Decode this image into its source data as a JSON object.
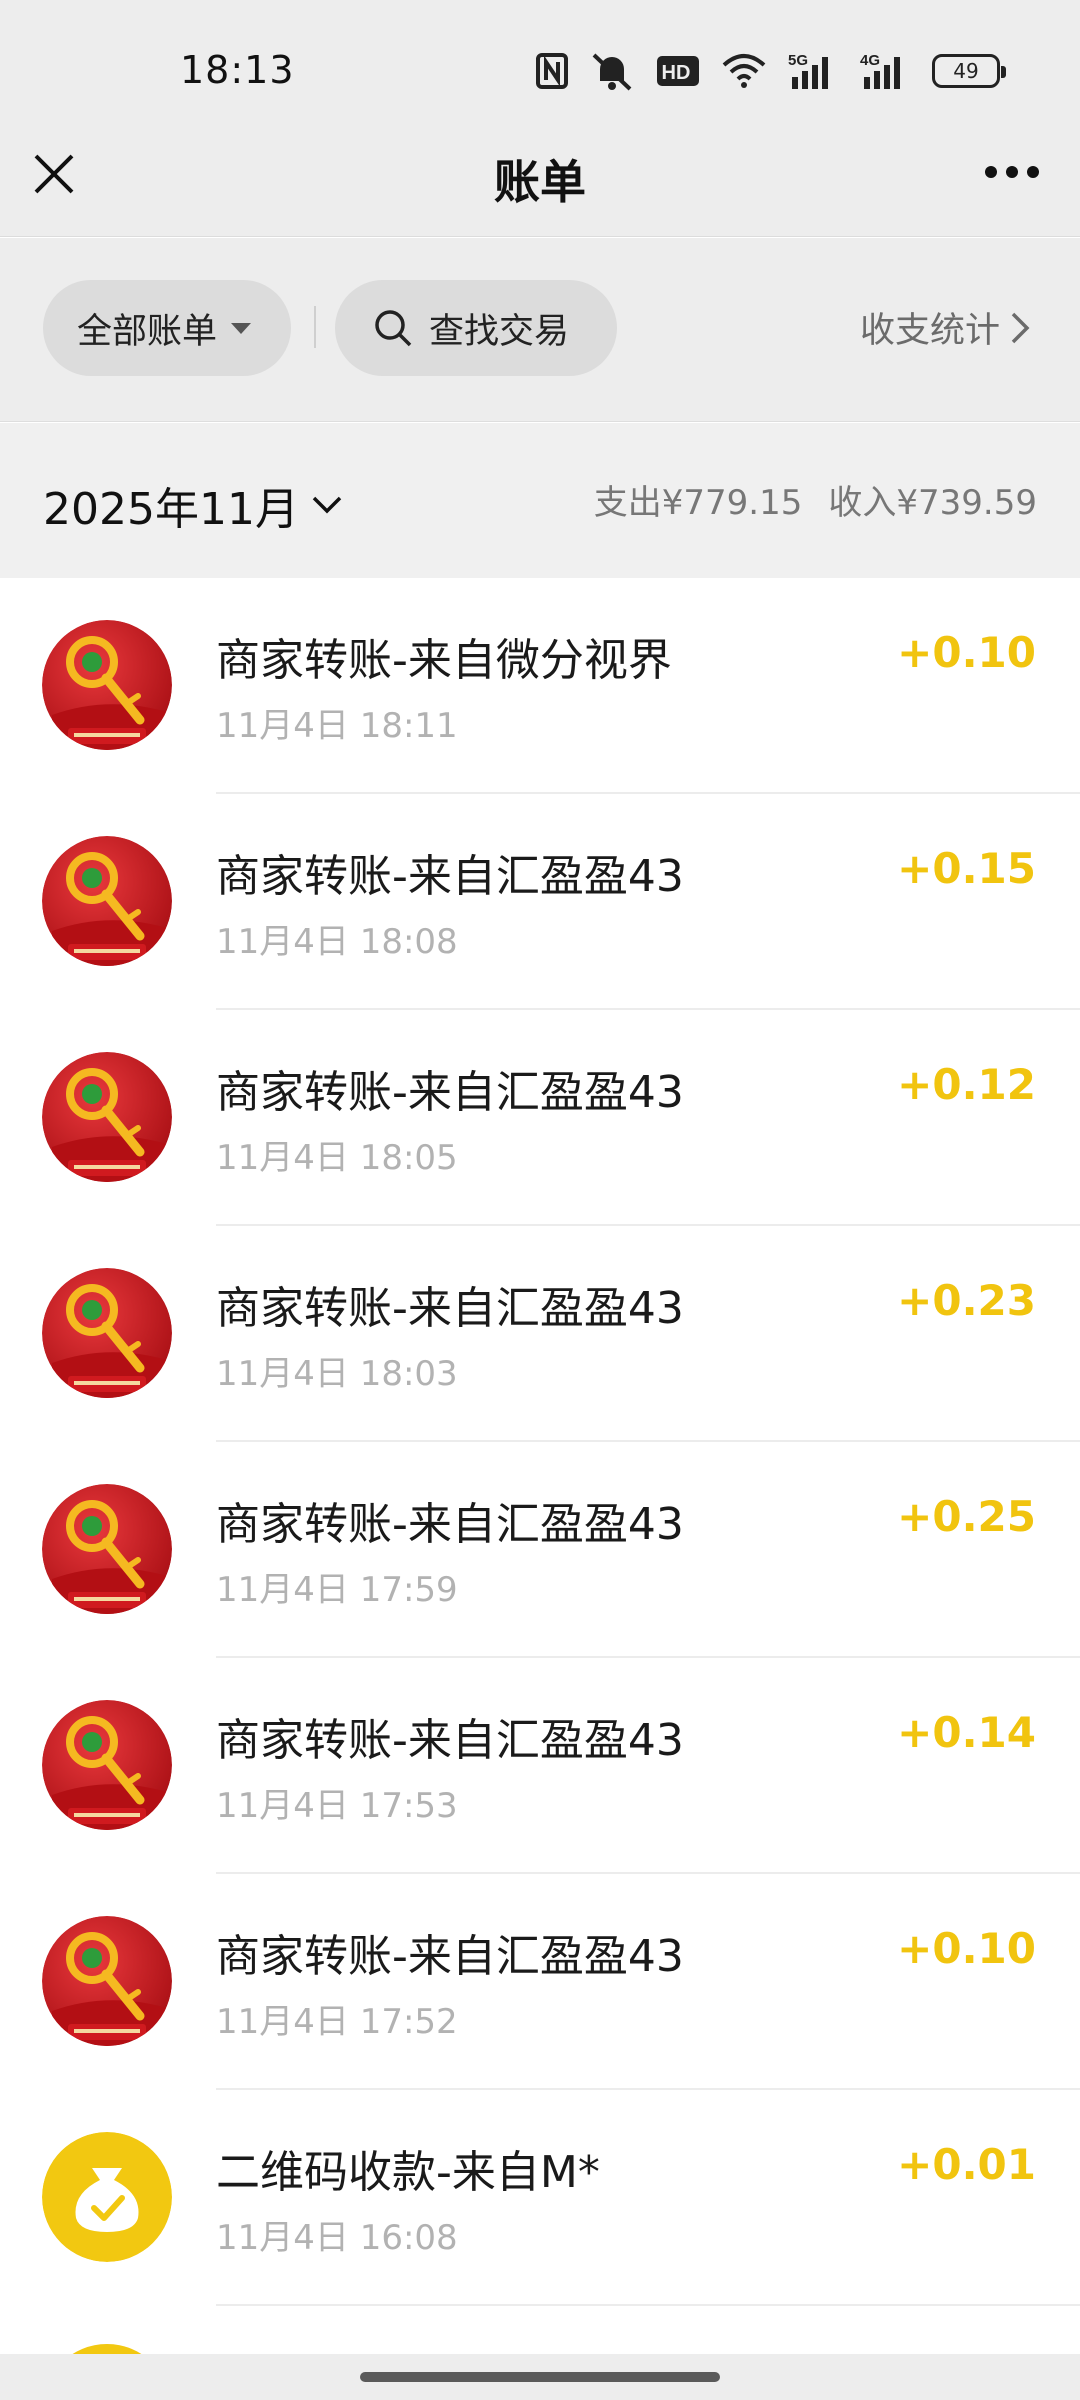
{
  "status_bar": {
    "time": "18:13",
    "hd_label": "HD",
    "net1": "5G",
    "net2": "4G",
    "battery": "49"
  },
  "nav": {
    "title": "账单",
    "close_icon": "close-icon",
    "more_icon": "more-icon"
  },
  "filter": {
    "all_bills": "全部账单",
    "search": "查找交易",
    "stats": "收支统计"
  },
  "month": {
    "label": "2025年11月",
    "expense": "支出¥779.15",
    "income": "收入¥739.59"
  },
  "colors": {
    "amount": "#f1c40f",
    "avatar_red": "#c8151b",
    "avatar_yellow": "#f2c811"
  },
  "transactions": [
    {
      "title": "商家转账-来自微分视界",
      "time": "11月4日 18:11",
      "amount": "+0.10",
      "avatar": "red-envelope-key"
    },
    {
      "title": "商家转账-来自汇盈盈43",
      "time": "11月4日 18:08",
      "amount": "+0.15",
      "avatar": "red-envelope-key"
    },
    {
      "title": "商家转账-来自汇盈盈43",
      "time": "11月4日 18:05",
      "amount": "+0.12",
      "avatar": "red-envelope-key"
    },
    {
      "title": "商家转账-来自汇盈盈43",
      "time": "11月4日 18:03",
      "amount": "+0.23",
      "avatar": "red-envelope-key"
    },
    {
      "title": "商家转账-来自汇盈盈43",
      "time": "11月4日 17:59",
      "amount": "+0.25",
      "avatar": "red-envelope-key"
    },
    {
      "title": "商家转账-来自汇盈盈43",
      "time": "11月4日 17:53",
      "amount": "+0.14",
      "avatar": "red-envelope-key"
    },
    {
      "title": "商家转账-来自汇盈盈43",
      "time": "11月4日 17:52",
      "amount": "+0.10",
      "avatar": "red-envelope-key"
    },
    {
      "title": "二维码收款-来自M*",
      "time": "11月4日 16:08",
      "amount": "+0.01",
      "avatar": "money-bag"
    }
  ]
}
